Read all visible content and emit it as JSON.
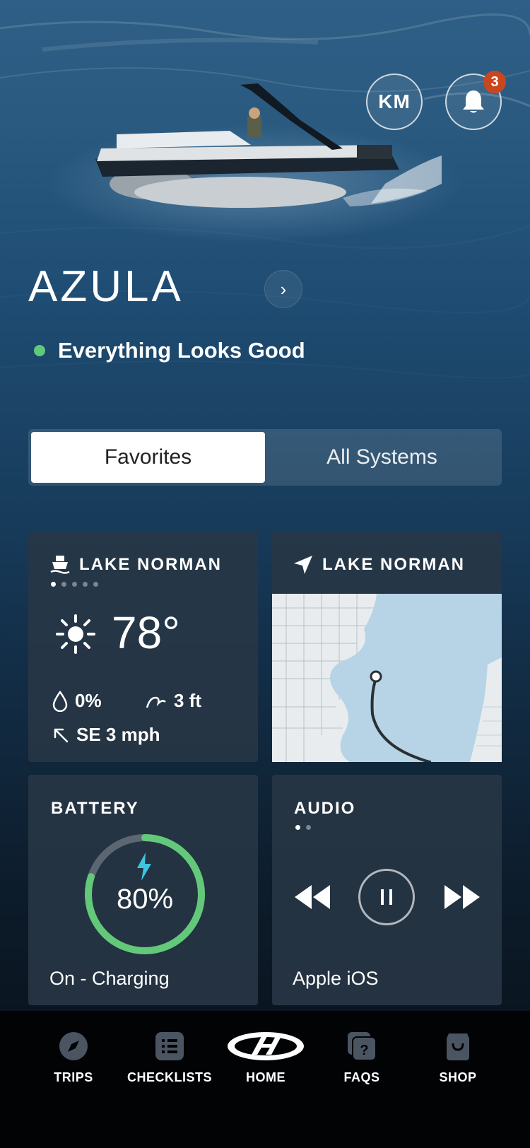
{
  "header": {
    "avatar_initials": "KM",
    "notification_count": "3",
    "boat_name": "AZULA",
    "status_text": "Everything Looks Good",
    "status_color": "#63c97a"
  },
  "segments": {
    "favorites": "Favorites",
    "all_systems": "All Systems",
    "active": "Favorites"
  },
  "weather_card": {
    "title": "LAKE NORMAN",
    "page_dots": 5,
    "active_dot": 1,
    "temperature": "78°",
    "precipitation": "0%",
    "waves": "3 ft",
    "wind": "SE 3 mph"
  },
  "location_card": {
    "title": "LAKE NORMAN"
  },
  "battery_card": {
    "title": "BATTERY",
    "percent_label": "80%",
    "level_fraction": 0.8,
    "status": "On - Charging",
    "ring_color": "#63c97a",
    "bolt_color": "#3fc4e0"
  },
  "audio_card": {
    "title": "AUDIO",
    "page_dots": 2,
    "active_dot": 1,
    "source": "Apple iOS"
  },
  "nav": {
    "trips": "TRIPS",
    "checklists": "CHECKLISTS",
    "home": "HOME",
    "faqs": "FAQS",
    "shop": "SHOP"
  },
  "icons": [
    "bell-icon",
    "chevron-right-icon",
    "boat-icon",
    "location-arrow-icon",
    "sun-icon",
    "drop-icon",
    "wave-icon",
    "wind-arrow-icon",
    "bolt-icon",
    "rewind-icon",
    "pause-icon",
    "fast-forward-icon",
    "compass-icon",
    "checklist-icon",
    "harris-logo-icon",
    "faq-icon",
    "shopping-bag-icon"
  ]
}
